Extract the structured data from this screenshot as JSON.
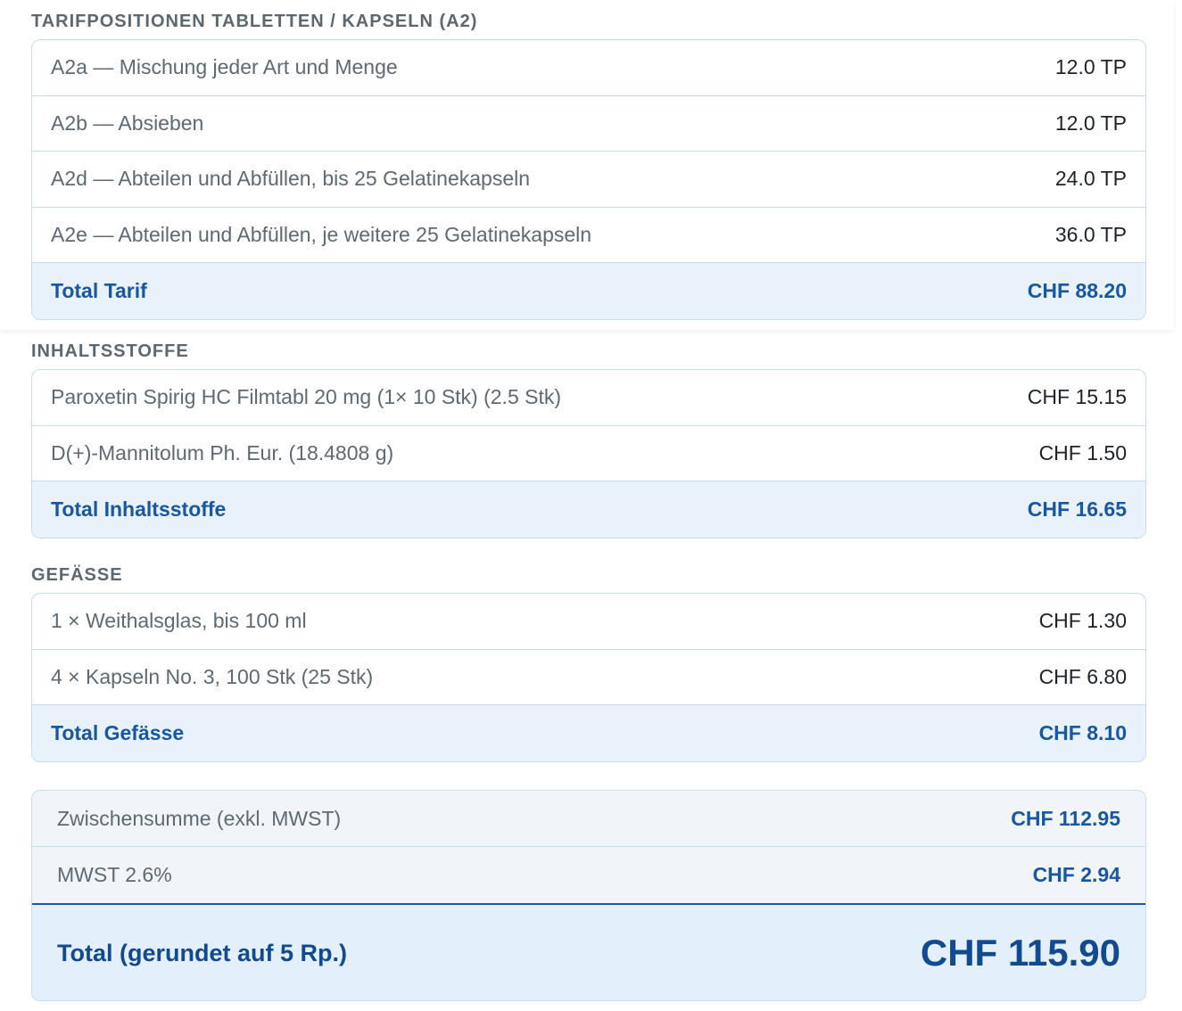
{
  "tarif": {
    "heading": "TARIFPOSITIONEN TABLETTEN / KAPSELN (A2)",
    "rows": [
      {
        "label": "A2a — Mischung jeder Art und Menge",
        "value": "12.0 TP"
      },
      {
        "label": "A2b — Absieben",
        "value": "12.0 TP"
      },
      {
        "label": "A2d — Abteilen und Abfüllen, bis 25 Gelatinekapseln",
        "value": "24.0 TP"
      },
      {
        "label": "A2e — Abteilen und Abfüllen, je weitere 25 Gelatinekapseln",
        "value": "36.0 TP"
      }
    ],
    "total_label": "Total Tarif",
    "total_value": "CHF 88.20"
  },
  "inhaltsstoffe": {
    "heading": "INHALTSSTOFFE",
    "rows": [
      {
        "label": "Paroxetin Spirig HC Filmtabl 20 mg (1× 10 Stk) (2.5 Stk)",
        "value": "CHF 15.15"
      },
      {
        "label": "D(+)-Mannitolum Ph. Eur. (18.4808 g)",
        "value": "CHF 1.50"
      }
    ],
    "total_label": "Total Inhaltsstoffe",
    "total_value": "CHF 16.65"
  },
  "gefaesse": {
    "heading": "GEFÄSSE",
    "rows": [
      {
        "label": "1 × Weithalsglas, bis 100 ml",
        "value": "CHF 1.30"
      },
      {
        "label": "4 × Kapseln No. 3, 100 Stk (25 Stk)",
        "value": "CHF 6.80"
      }
    ],
    "total_label": "Total Gefässe",
    "total_value": "CHF 8.10"
  },
  "summary": {
    "subtotal_label": "Zwischensumme (exkl. MWST)",
    "subtotal_value": "CHF 112.95",
    "vat_label": "MWST 2.6%",
    "vat_value": "CHF 2.94",
    "grand_label": "Total (gerundet auf 5 Rp.)",
    "grand_value": "CHF 115.90"
  },
  "colors": {
    "accent": "#1857a4",
    "border": "#c4def0",
    "total_row_bg": "#e9f2fb",
    "grand_bg": "#e3f0fb"
  }
}
